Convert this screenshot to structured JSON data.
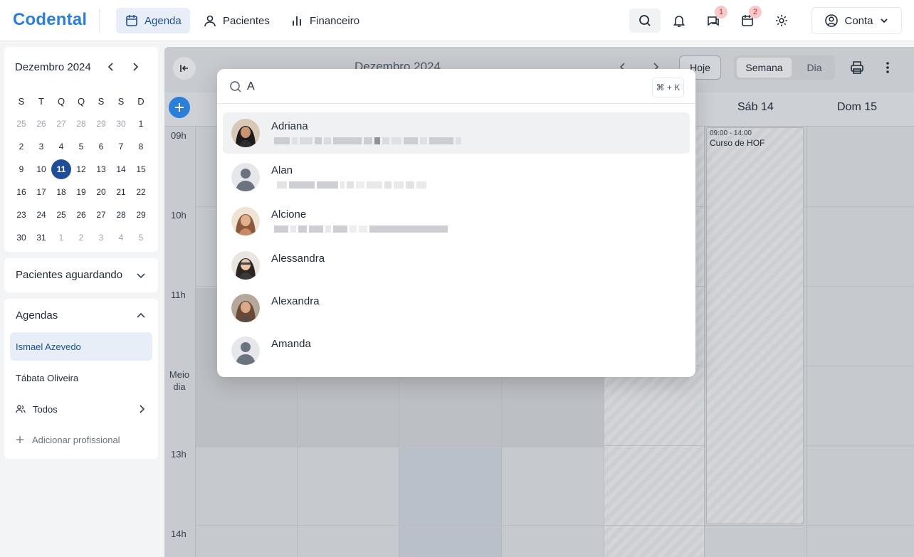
{
  "app": {
    "logo": "Codental"
  },
  "nav": {
    "agenda": "Agenda",
    "pacientes": "Pacientes",
    "financeiro": "Financeiro"
  },
  "topbar": {
    "chat_badge": "1",
    "calendar_badge": "2",
    "account_label": "Conta"
  },
  "mini_calendar": {
    "title": "Dezembro 2024",
    "weekdays": [
      "S",
      "T",
      "Q",
      "Q",
      "S",
      "S",
      "D"
    ],
    "weeks": [
      [
        "25",
        "26",
        "27",
        "28",
        "29",
        "30",
        "1"
      ],
      [
        "2",
        "3",
        "4",
        "5",
        "6",
        "7",
        "8"
      ],
      [
        "9",
        "10",
        "11",
        "12",
        "13",
        "14",
        "15"
      ],
      [
        "16",
        "17",
        "18",
        "19",
        "20",
        "21",
        "22"
      ],
      [
        "23",
        "24",
        "25",
        "26",
        "27",
        "28",
        "29"
      ],
      [
        "30",
        "31",
        "1",
        "2",
        "3",
        "4",
        "5"
      ]
    ],
    "selected": "11"
  },
  "sidebar": {
    "waiting_title": "Pacientes aguardando",
    "agendas_title": "Agendas",
    "agendas": [
      "Ismael Azevedo",
      "Tábata Oliveira"
    ],
    "todos": "Todos",
    "add_professional": "Adicionar profissional"
  },
  "calendar": {
    "title": "Dezembro 2024",
    "today_button": "Hoje",
    "view_week": "Semana",
    "view_day": "Dia",
    "day_headers": [
      "Sáb 14",
      "Dom 15"
    ],
    "times": [
      "09h",
      "10h",
      "11h",
      "Meio dia",
      "13h",
      "14h"
    ],
    "event": {
      "time": "09:00 - 14:00",
      "title": "Curso de HOF"
    }
  },
  "search": {
    "query": "A",
    "shortcut": "⌘ + K",
    "results": [
      {
        "name": "Adriana",
        "avatar": "photo"
      },
      {
        "name": "Alan",
        "avatar": "placeholder"
      },
      {
        "name": "Alcione",
        "avatar": "photo"
      },
      {
        "name": "Alessandra",
        "avatar": "photo"
      },
      {
        "name": "Alexandra",
        "avatar": "photo"
      },
      {
        "name": "Amanda",
        "avatar": "placeholder"
      }
    ]
  },
  "colors": {
    "brand": "#2b7fd9",
    "active_nav": "#1f4e96",
    "badge": "#f8c9c9"
  }
}
